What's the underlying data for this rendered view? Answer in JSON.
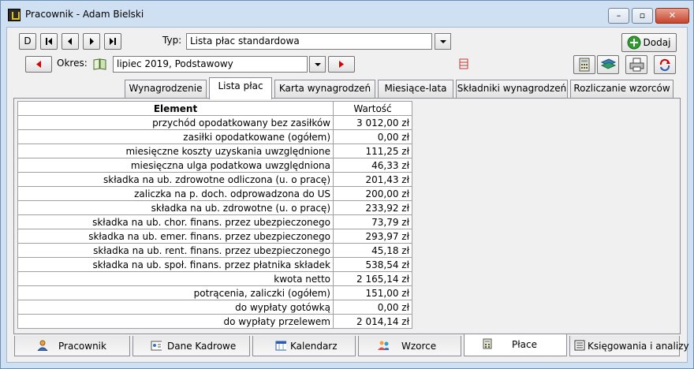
{
  "window": {
    "title": "Pracownik - Adam Bielski",
    "min_label": "–",
    "max_label": "▫",
    "close_label": "✕"
  },
  "toolbar": {
    "first_label": "D",
    "typ_label": "Typ:",
    "typ_value": "Lista płac standardowa",
    "okres_label": "Okres:",
    "okres_value": "lipiec 2019, Podstawowy",
    "add_label": "Dodaj"
  },
  "top_tabs": [
    {
      "label": "Wynagrodzenie"
    },
    {
      "label": "Lista płac"
    },
    {
      "label": "Karta wynagrodzeń"
    },
    {
      "label": "Miesiące-lata"
    },
    {
      "label": "Składniki wynagrodzeń"
    },
    {
      "label": "Rozliczanie wzorców"
    }
  ],
  "table": {
    "headers": [
      "Element",
      "Wartość"
    ],
    "rows": [
      {
        "element": "przychód opodatkowany bez zasiłków",
        "value": "3 012,00 zł"
      },
      {
        "element": "zasiłki opodatkowane (ogółem)",
        "value": "0,00 zł"
      },
      {
        "element": "miesięczne koszty uzyskania uwzględnione",
        "value": "111,25 zł"
      },
      {
        "element": "miesięczna ulga podatkowa uwzględniona",
        "value": "46,33 zł"
      },
      {
        "element": "składka na ub. zdrowotne odliczona (u. o pracę)",
        "value": "201,43 zł"
      },
      {
        "element": "zaliczka na p. doch. odprowadzona do US",
        "value": "200,00 zł"
      },
      {
        "element": "składka na ub. zdrowotne (u. o pracę)",
        "value": "233,92 zł"
      },
      {
        "element": "składka na ub. chor. finans. przez ubezpieczonego",
        "value": "73,79 zł"
      },
      {
        "element": "składka na ub. emer. finans. przez ubezpieczonego",
        "value": "293,97 zł"
      },
      {
        "element": "składka na ub. rent. finans. przez ubezpieczonego",
        "value": "45,18 zł"
      },
      {
        "element": "składka na ub. społ. finans. przez płatnika składek",
        "value": "538,54 zł"
      },
      {
        "element": "kwota netto",
        "value": "2 165,14 zł"
      },
      {
        "element": "potrącenia, zaliczki (ogółem)",
        "value": "151,00 zł"
      },
      {
        "element": "do wypłaty gotówką",
        "value": "0,00 zł"
      },
      {
        "element": "do wypłaty przelewem",
        "value": "2 014,14 zł"
      }
    ]
  },
  "bottom_tabs": [
    {
      "label": "Pracownik",
      "icon": "person-icon"
    },
    {
      "label": "Dane Kadrowe",
      "icon": "id-card-icon"
    },
    {
      "label": "Kalendarz",
      "icon": "calendar-icon"
    },
    {
      "label": "Wzorce",
      "icon": "people-icon"
    },
    {
      "label": "Płace",
      "icon": "calculator-icon"
    },
    {
      "label": "Księgowania i analizy",
      "icon": "ledger-icon"
    }
  ],
  "colors": {
    "accent_red": "#d60000",
    "add_green": "#2e9c2e",
    "window_frame": "#cfe0f3"
  }
}
